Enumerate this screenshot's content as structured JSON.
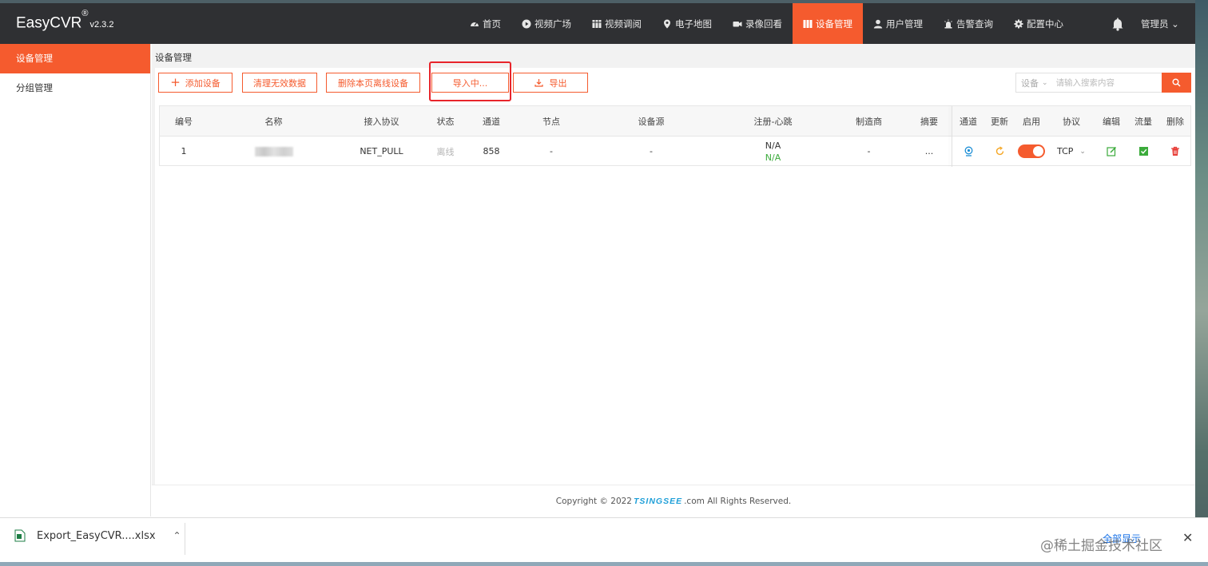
{
  "app": {
    "name": "EasyCVR",
    "reg": "®",
    "version": "v2.3.2"
  },
  "nav": {
    "items": [
      {
        "label": "首页",
        "icon": "dashboard-icon"
      },
      {
        "label": "视频广场",
        "icon": "play-circle-icon"
      },
      {
        "label": "视频调阅",
        "icon": "grid-icon"
      },
      {
        "label": "电子地图",
        "icon": "map-marker-icon"
      },
      {
        "label": "录像回看",
        "icon": "video-camera-icon"
      },
      {
        "label": "设备管理",
        "icon": "device-icon",
        "active": true
      },
      {
        "label": "用户管理",
        "icon": "user-icon"
      },
      {
        "label": "告警查询",
        "icon": "alarm-icon"
      },
      {
        "label": "配置中心",
        "icon": "gear-icon"
      }
    ],
    "admin_label": "管理员 ⌄"
  },
  "sidebar": {
    "items": [
      {
        "label": "设备管理",
        "active": true
      },
      {
        "label": "分组管理",
        "active": false
      }
    ]
  },
  "page": {
    "title": "设备管理",
    "buttons": {
      "add": "添加设备",
      "clean": "清理无效数据",
      "delete_offline": "删除本页离线设备",
      "importing": "导入中...",
      "export": "导出"
    },
    "search": {
      "select": "设备",
      "placeholder": "请输入搜索内容"
    }
  },
  "table": {
    "headers": [
      "编号",
      "名称",
      "接入协议",
      "状态",
      "通道",
      "节点",
      "设备源",
      "注册-心跳",
      "制造商",
      "摘要",
      "通道",
      "更新",
      "启用",
      "协议",
      "编辑",
      "流量",
      "删除"
    ],
    "rows": [
      {
        "id": "1",
        "protocol": "NET_PULL",
        "status": "离线",
        "channels": "858",
        "node": "-",
        "source": "-",
        "register": "N/A",
        "heartbeat": "N/A",
        "maker": "-",
        "summary": "...",
        "transport": "TCP"
      }
    ]
  },
  "footer": {
    "prefix": "Copyright © 2022",
    "logo": "TSINGSEE",
    "suffix": ".com All Rights Reserved."
  },
  "download": {
    "file": "Export_EasyCVR....xlsx",
    "show_all": "全部显示",
    "close": "✕"
  },
  "watermark": "@稀土掘金技术社区",
  "colors": {
    "accent": "#f55b2e",
    "topbar": "#2f3033",
    "highlight": "#e8252b",
    "green": "#3bab3b"
  }
}
